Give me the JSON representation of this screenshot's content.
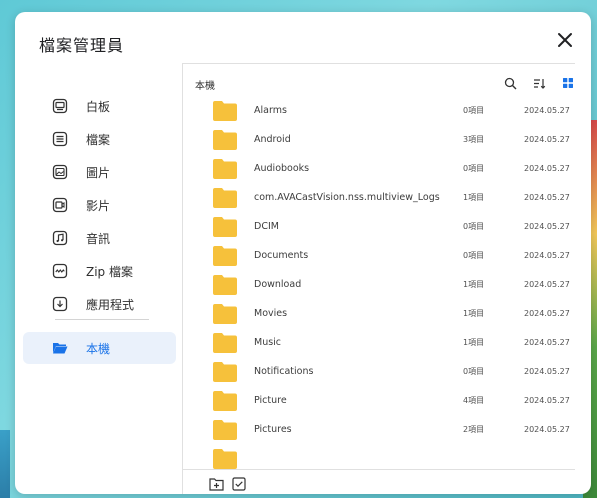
{
  "dialog": {
    "title": "檔案管理員",
    "close_icon": "close-icon"
  },
  "sidebar": {
    "items": [
      {
        "label": "白板",
        "icon": "whiteboard-icon"
      },
      {
        "label": "檔案",
        "icon": "document-icon"
      },
      {
        "label": "圖片",
        "icon": "image-icon"
      },
      {
        "label": "影片",
        "icon": "video-icon"
      },
      {
        "label": "音訊",
        "icon": "audio-icon"
      },
      {
        "label": "Zip 檔案",
        "icon": "zip-icon"
      },
      {
        "label": "應用程式",
        "icon": "app-download-icon"
      },
      {
        "label": "本機",
        "icon": "folder-open-icon",
        "active": true
      }
    ]
  },
  "content": {
    "breadcrumb": "本機",
    "tools": [
      "search-icon",
      "sort-icon",
      "grid-view-icon"
    ],
    "files": [
      {
        "name": "Alarms",
        "count": "0項目",
        "date": "2024.05.27"
      },
      {
        "name": "Android",
        "count": "3項目",
        "date": "2024.05.27"
      },
      {
        "name": "Audiobooks",
        "count": "0項目",
        "date": "2024.05.27"
      },
      {
        "name": "com.AVACastVision.nss.multiview_Logs",
        "count": "1項目",
        "date": "2024.05.27"
      },
      {
        "name": "DCIM",
        "count": "0項目",
        "date": "2024.05.27"
      },
      {
        "name": "Documents",
        "count": "0項目",
        "date": "2024.05.27"
      },
      {
        "name": "Download",
        "count": "1項目",
        "date": "2024.05.27"
      },
      {
        "name": "Movies",
        "count": "1項目",
        "date": "2024.05.27"
      },
      {
        "name": "Music",
        "count": "1項目",
        "date": "2024.05.27"
      },
      {
        "name": "Notifications",
        "count": "0項目",
        "date": "2024.05.27"
      },
      {
        "name": "Picture",
        "count": "4項目",
        "date": "2024.05.27"
      },
      {
        "name": "Pictures",
        "count": "2項目",
        "date": "2024.05.27"
      },
      {
        "name": "",
        "count": "",
        "date": ""
      }
    ],
    "bottom_tools": [
      "new-folder-icon",
      "select-checkbox-icon"
    ]
  },
  "colors": {
    "accent": "#1a73e8",
    "folder": "#f6c13b",
    "active_bg": "#eaf1fb"
  }
}
